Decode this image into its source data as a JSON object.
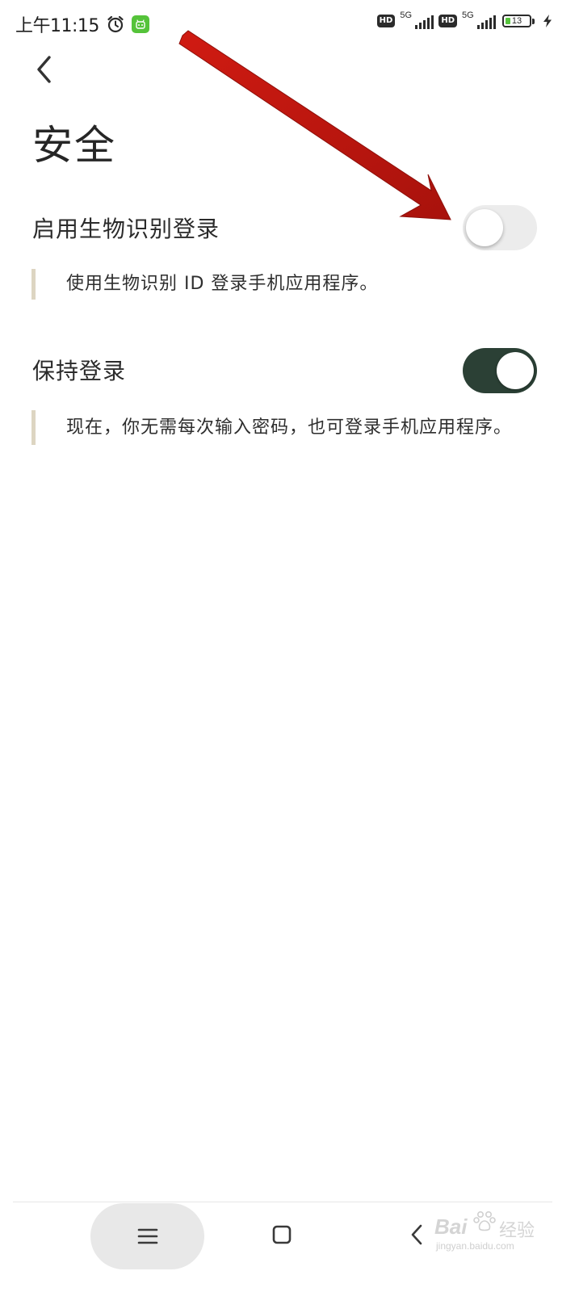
{
  "status_bar": {
    "time": "上午11:15",
    "alarm_icon": "alarm-clock-icon",
    "app_icon": "android-app-icon",
    "sim1": {
      "hd": "HD",
      "network": "5G",
      "signal_bars": 4
    },
    "sim2": {
      "hd": "HD",
      "network": "5G",
      "signal_bars": 4
    },
    "battery": {
      "level": "13",
      "charging": true
    },
    "colors": {
      "battery_fill": "#57c43d",
      "app_icon_bg": "#55c33a"
    }
  },
  "header": {
    "back_icon": "chevron-left-icon",
    "title": "安全"
  },
  "settings": [
    {
      "label": "启用生物识别登录",
      "description": "使用生物识别 ID 登录手机应用程序。",
      "enabled": false
    },
    {
      "label": "保持登录",
      "description": "现在，你无需每次输入密码，也可登录手机应用程序。",
      "enabled": true
    }
  ],
  "annotation": {
    "type": "arrow",
    "color": "#c0170f",
    "points_to": "biometric-login-toggle"
  },
  "nav_bar": {
    "menu_icon": "hamburger-menu-icon",
    "home_icon": "square-home-icon",
    "back_icon": "chevron-left-icon"
  },
  "watermark": {
    "brand": "Bai",
    "brand_suffix": "经验",
    "url": "jingyan.baidu.com"
  },
  "colors": {
    "toggle_on": "#2b4035",
    "toggle_off": "#ececec",
    "description_bar": "#ddd5c2"
  }
}
